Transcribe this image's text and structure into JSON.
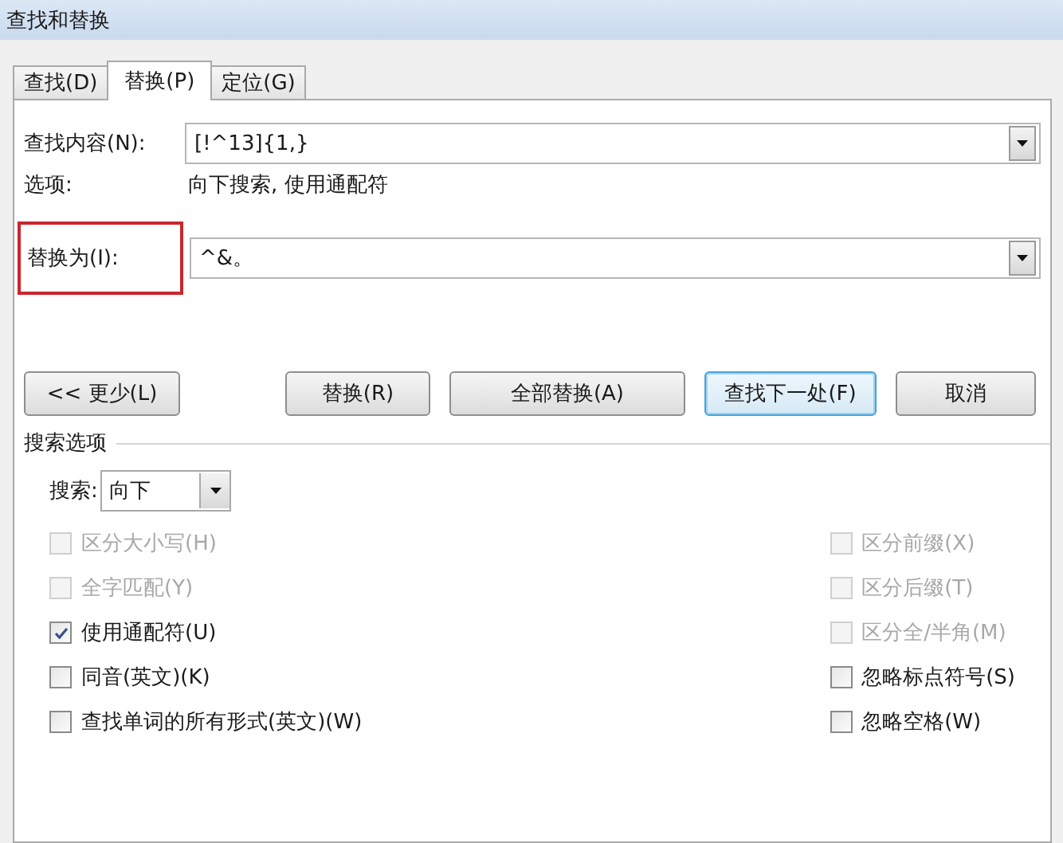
{
  "window": {
    "title": "查找和替换"
  },
  "tabs": [
    {
      "label": "查找(D)",
      "selected": false
    },
    {
      "label": "替换(P)",
      "selected": true
    },
    {
      "label": "定位(G)",
      "selected": false
    }
  ],
  "find": {
    "label": "查找内容(N):",
    "value": "[!^13]{1,}"
  },
  "options": {
    "label": "选项:",
    "value": "向下搜索, 使用通配符"
  },
  "replace": {
    "label": "替换为(I):",
    "value": "^&。",
    "highlighted": true
  },
  "buttons": [
    {
      "label": "<< 更少(L)",
      "focused": false
    },
    {
      "label": "替换(R)",
      "focused": false
    },
    {
      "label": "全部替换(A)",
      "focused": false
    },
    {
      "label": "查找下一处(F)",
      "focused": true
    },
    {
      "label": "取消",
      "focused": false
    }
  ],
  "search_options": {
    "title": "搜索选项",
    "direction_label": "搜索:",
    "direction": "向下"
  },
  "left_checks": [
    {
      "label": "区分大小写(H)",
      "checked": false,
      "disabled": true
    },
    {
      "label": "全字匹配(Y)",
      "checked": false,
      "disabled": true
    },
    {
      "label": "使用通配符(U)",
      "checked": true,
      "disabled": false
    },
    {
      "label": "同音(英文)(K)",
      "checked": false,
      "disabled": false
    },
    {
      "label": "查找单词的所有形式(英文)(W)",
      "checked": false,
      "disabled": false
    }
  ],
  "right_checks": [
    {
      "label": "区分前缀(X)",
      "checked": false,
      "disabled": true
    },
    {
      "label": "区分后缀(T)",
      "checked": false,
      "disabled": true
    },
    {
      "label": "区分全/半角(M)",
      "checked": false,
      "disabled": true
    },
    {
      "label": "忽略标点符号(S)",
      "checked": false,
      "disabled": false
    },
    {
      "label": "忽略空格(W)",
      "checked": false,
      "disabled": false
    }
  ]
}
